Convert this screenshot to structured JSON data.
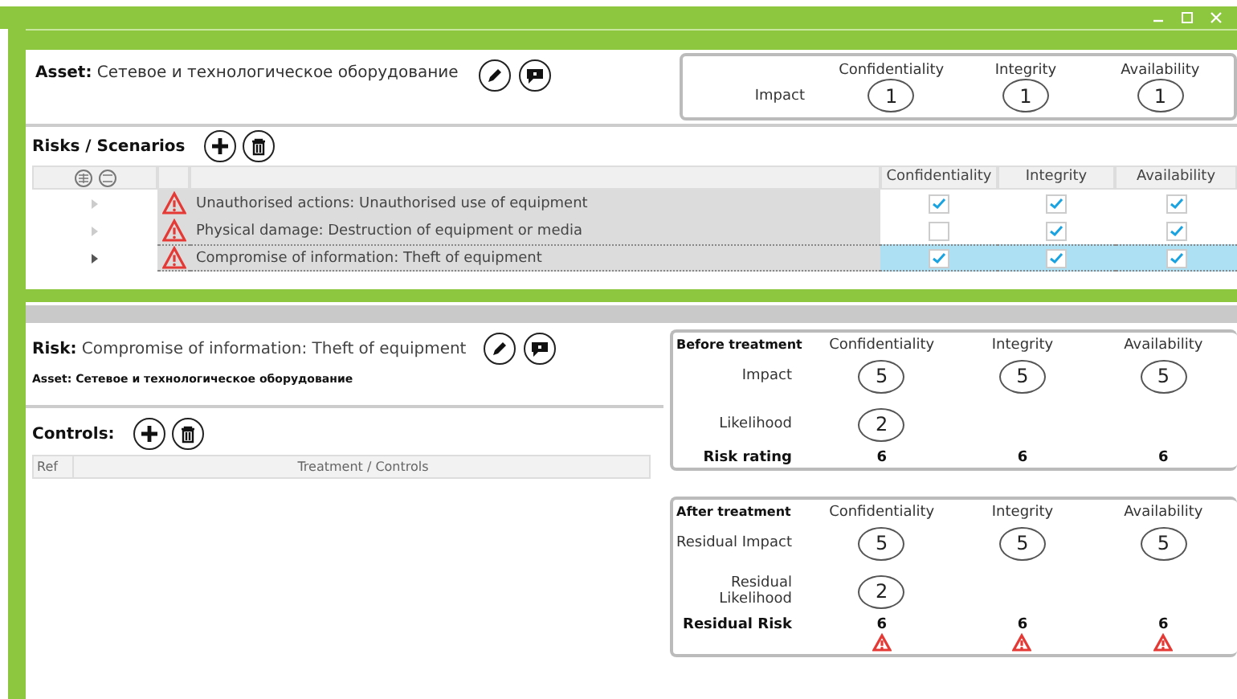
{
  "asset": {
    "label": "Asset:",
    "name": "Сетевое и технологическое оборудование"
  },
  "asset_impact": {
    "columns": [
      "Confidentiality",
      "Integrity",
      "Availability"
    ],
    "row_label": "Impact",
    "values": [
      "1",
      "1",
      "1"
    ]
  },
  "risks": {
    "title": "Risks  / Scenarios",
    "columns": [
      "Confidentiality",
      "Integrity",
      "Availability"
    ],
    "rows": [
      {
        "name": "Unauthorised actions: Unauthorised use of equipment",
        "selected": false,
        "checks": [
          true,
          true,
          true
        ]
      },
      {
        "name": "Physical  damage: Destruction of equipment or media",
        "selected": false,
        "checks": [
          false,
          true,
          true
        ]
      },
      {
        "name": "Compromise of information: Theft of equipment",
        "selected": true,
        "checks": [
          true,
          true,
          true
        ]
      }
    ]
  },
  "risk_detail": {
    "label": "Risk:",
    "name": "Compromise of information: Theft of equipment",
    "asset_line": "Asset: Сетевое и технологическое оборудование"
  },
  "controls": {
    "title": "Controls:",
    "columns": [
      "Ref",
      "Treatment / Controls"
    ]
  },
  "before": {
    "title": "Before treatment",
    "columns": [
      "Confidentiality",
      "Integrity",
      "Availability"
    ],
    "impact_label": "Impact",
    "impact": [
      "5",
      "5",
      "5"
    ],
    "likelihood_label": "Likelihood",
    "likelihood": "2",
    "rating_label": "Risk rating",
    "rating": [
      "6",
      "6",
      "6"
    ]
  },
  "after": {
    "title": "After treatment",
    "columns": [
      "Confidentiality",
      "Integrity",
      "Availability"
    ],
    "impact_label": "Residual Impact",
    "impact": [
      "5",
      "5",
      "5"
    ],
    "likelihood_label": "Residual Likelihood",
    "likelihood": "2",
    "rating_label": "Residual Risk",
    "rating": [
      "6",
      "6",
      "6"
    ],
    "warnings": [
      true,
      true,
      true
    ]
  }
}
